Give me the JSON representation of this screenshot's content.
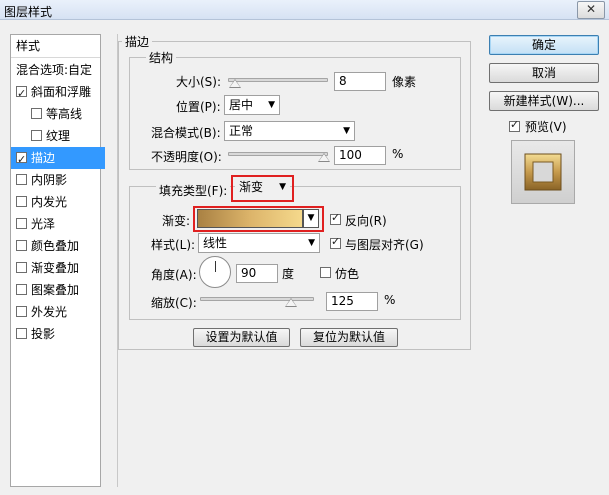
{
  "window": {
    "title": "图层样式",
    "close_glyph": "✕"
  },
  "sidebar": {
    "header": "样式",
    "items": [
      {
        "label": "混合选项:自定",
        "checkbox": null,
        "checked": false,
        "selected": false
      },
      {
        "label": "斜面和浮雕",
        "checkbox": true,
        "checked": true,
        "selected": false
      },
      {
        "label": "等高线",
        "checkbox": true,
        "checked": false,
        "selected": false
      },
      {
        "label": "纹理",
        "checkbox": true,
        "checked": false,
        "selected": false
      },
      {
        "label": "描边",
        "checkbox": true,
        "checked": true,
        "selected": true
      },
      {
        "label": "内阴影",
        "checkbox": true,
        "checked": false,
        "selected": false
      },
      {
        "label": "内发光",
        "checkbox": true,
        "checked": false,
        "selected": false
      },
      {
        "label": "光泽",
        "checkbox": true,
        "checked": false,
        "selected": false
      },
      {
        "label": "颜色叠加",
        "checkbox": true,
        "checked": false,
        "selected": false
      },
      {
        "label": "渐变叠加",
        "checkbox": true,
        "checked": false,
        "selected": false
      },
      {
        "label": "图案叠加",
        "checkbox": true,
        "checked": false,
        "selected": false
      },
      {
        "label": "外发光",
        "checkbox": true,
        "checked": false,
        "selected": false
      },
      {
        "label": "投影",
        "checkbox": true,
        "checked": false,
        "selected": false
      }
    ]
  },
  "stroke": {
    "group_title": "描边",
    "structure_title": "结构",
    "size_label": "大小(S):",
    "size_value": "8",
    "size_unit": "像素",
    "position_label": "位置(P):",
    "position_value": "居中",
    "blend_label": "混合模式(B):",
    "blend_value": "正常",
    "opacity_label": "不透明度(O):",
    "opacity_value": "100",
    "opacity_unit": "%",
    "fill_type_label": "填充类型(F):",
    "fill_type_value": "渐变",
    "gradient_label": "渐变:",
    "reverse_label": "反向(R)",
    "reverse_checked": true,
    "style_label": "样式(L):",
    "style_value": "线性",
    "align_label": "与图层对齐(G)",
    "align_checked": true,
    "angle_label": "角度(A):",
    "angle_value": "90",
    "angle_unit": "度",
    "dither_label": "仿色",
    "dither_checked": false,
    "scale_label": "缩放(C):",
    "scale_value": "125",
    "scale_unit": "%",
    "set_default_label": "设置为默认值",
    "reset_default_label": "复位为默认值"
  },
  "buttons": {
    "ok": "确定",
    "cancel": "取消",
    "new_style": "新建样式(W)...",
    "preview_label": "预览(V)",
    "preview_checked": true
  },
  "colors": {
    "selection": "#3399ff",
    "highlight_box": "#e02020",
    "gradient_from": "#a98143",
    "gradient_to": "#f5d98c"
  }
}
